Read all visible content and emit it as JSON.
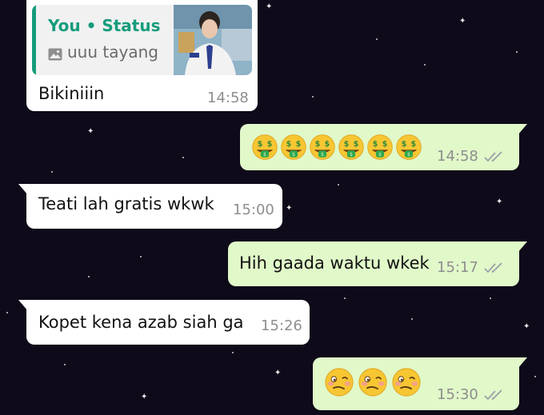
{
  "theme": {
    "background": "#0f0a1a",
    "incoming_bubble": "#ffffff",
    "outgoing_bubble": "#e1f8c9",
    "quote_accent": "#169c7c",
    "read_ticks": "#9aa0a6"
  },
  "messages": [
    {
      "direction": "incoming",
      "quote": {
        "title": "You • Status",
        "text": "uuu tayang",
        "media_icon": "photo-icon"
      },
      "text": "Bikiniiin",
      "time": "14:58"
    },
    {
      "direction": "outgoing",
      "emoji": {
        "name": "money-mouth-face-emoji",
        "count": 6
      },
      "time": "14:58",
      "status": "read-double-check-icon"
    },
    {
      "direction": "incoming",
      "text": "Teati lah gratis wkwk",
      "time": "15:00"
    },
    {
      "direction": "outgoing",
      "text": "Hih gaada waktu wkek",
      "time": "15:17",
      "status": "read-double-check-icon"
    },
    {
      "direction": "incoming",
      "text": "Kopet kena azab siah ga",
      "time": "15:26"
    },
    {
      "direction": "outgoing",
      "emoji": {
        "name": "woozy-face-emoji",
        "count": 3
      },
      "time": "15:30",
      "status": "read-double-check-icon"
    }
  ]
}
